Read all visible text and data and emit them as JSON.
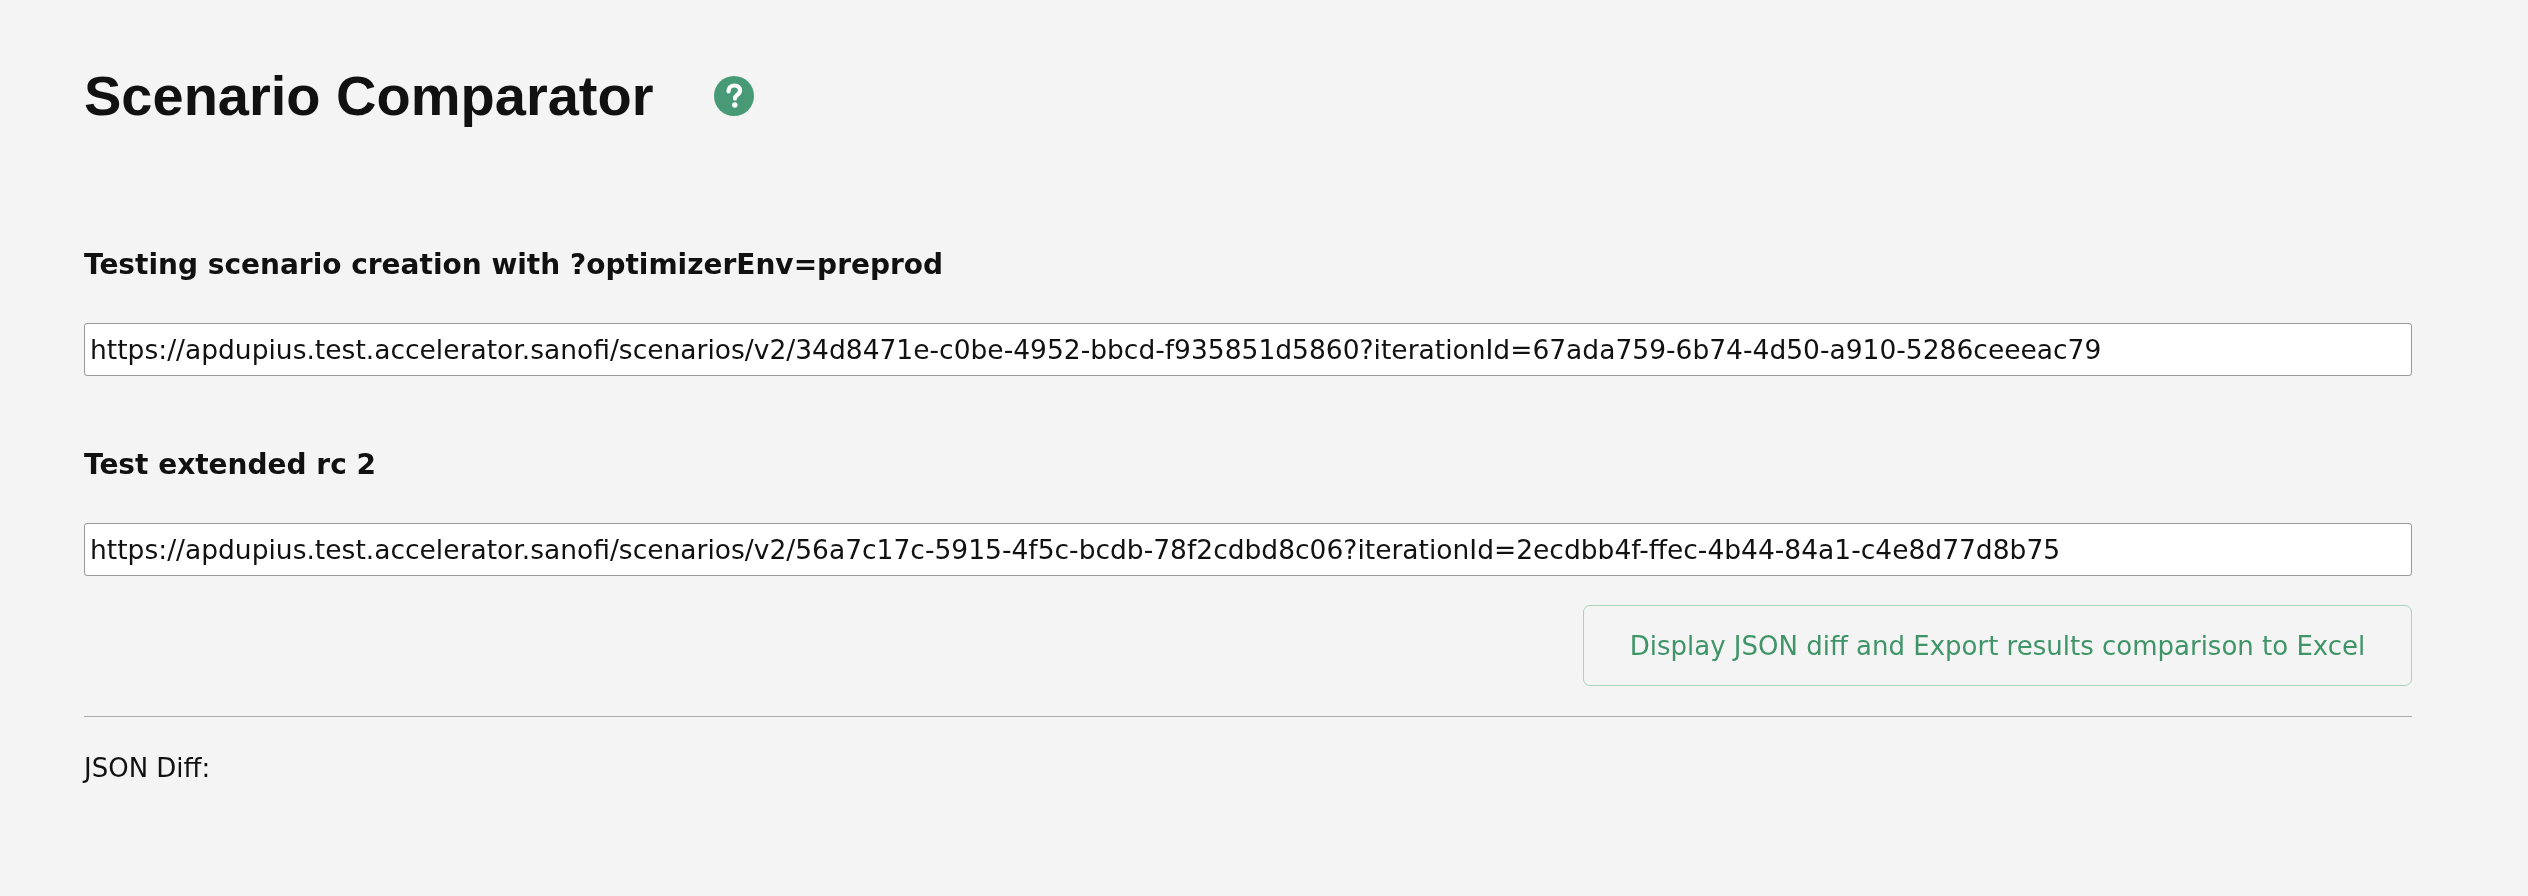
{
  "page": {
    "title": "Scenario Comparator"
  },
  "scenarios": [
    {
      "heading": "Testing scenario creation with ?optimizerEnv=preprod",
      "url": "https://apdupius.test.accelerator.sanofi/scenarios/v2/34d8471e-c0be-4952-bbcd-f935851d5860?iterationId=67ada759-6b74-4d50-a910-5286ceeeac79"
    },
    {
      "heading": "Test extended rc 2",
      "url": "https://apdupius.test.accelerator.sanofi/scenarios/v2/56a7c17c-5915-4f5c-bcdb-78f2cdbd8c06?iterationId=2ecdbb4f-ffec-4b44-84a1-c4e8d77d8b75"
    }
  ],
  "action_button": {
    "label": "Display JSON diff and Export results comparison to Excel"
  },
  "result": {
    "label": "JSON Diff:"
  }
}
